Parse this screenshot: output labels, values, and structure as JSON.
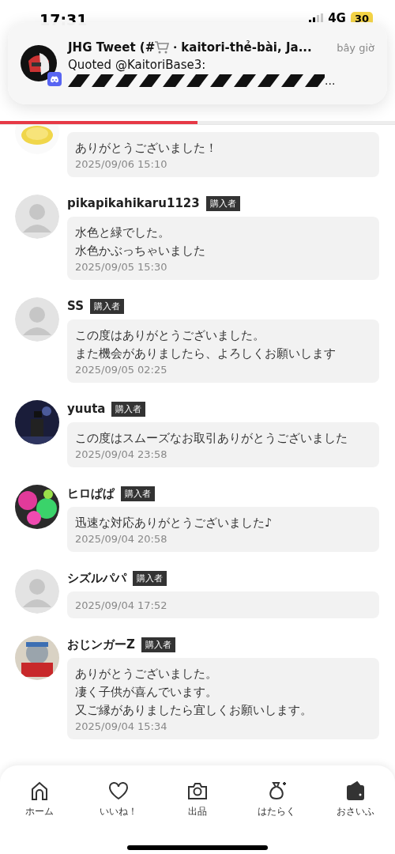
{
  "status_bar": {
    "time": "17:31",
    "network": "4G",
    "battery": "30"
  },
  "notification": {
    "title_start": "JHG Tweet (#",
    "title_end": "・kaitori-thẻ-bài, Ja...",
    "time": "bây giờ",
    "line": "Quoted @KaitoriBase3:",
    "ellipsis": "..."
  },
  "tabs": [
    {
      "selected": true
    },
    {
      "selected": false
    }
  ],
  "reviews": [
    {
      "avatar": {
        "kind": "coin"
      },
      "message": [
        "ありがとうございました！"
      ],
      "date": "2025/09/06 15:10"
    },
    {
      "name": "pikapikahikaru1123",
      "badge": "購入者",
      "avatar": {
        "kind": "default"
      },
      "message": [
        "水色と緑でした。",
        "水色かぶっちゃいました"
      ],
      "date": "2025/09/05 15:30"
    },
    {
      "name": "SS",
      "badge": "購入者",
      "avatar": {
        "kind": "default"
      },
      "message": [
        "この度はありがとうございました。",
        "また機会がありましたら、よろしくお願いします"
      ],
      "date": "2025/09/05 02:25"
    },
    {
      "name": "yuuta",
      "badge": "購入者",
      "avatar": {
        "kind": "night"
      },
      "message": [
        "この度はスムーズなお取引ありがとうございました"
      ],
      "date": "2025/09/04 23:58"
    },
    {
      "name": "ヒロぱぱ",
      "badge": "購入者",
      "avatar": {
        "kind": "splash"
      },
      "message": [
        "迅速な対応ありがとうございました♪"
      ],
      "date": "2025/09/04 20:58"
    },
    {
      "name": "シズルパパ",
      "badge": "購入者",
      "avatar": {
        "kind": "default"
      },
      "date": "2025/09/04 17:52"
    },
    {
      "name": "おじンガーZ",
      "badge": "購入者",
      "avatar": {
        "kind": "toy"
      },
      "message": [
        "ありがとうございました。",
        "凄く子供が喜んでいます。",
        "又ご縁がありましたら宜しくお願いします。"
      ],
      "date": "2025/09/04 15:34"
    }
  ],
  "nav": [
    {
      "label": "ホーム",
      "kind": "home"
    },
    {
      "label": "いいね！",
      "kind": "heart"
    },
    {
      "label": "出品",
      "kind": "camera"
    },
    {
      "label": "はたらく",
      "kind": "bag"
    },
    {
      "label": "おさいふ",
      "kind": "wallet"
    }
  ]
}
